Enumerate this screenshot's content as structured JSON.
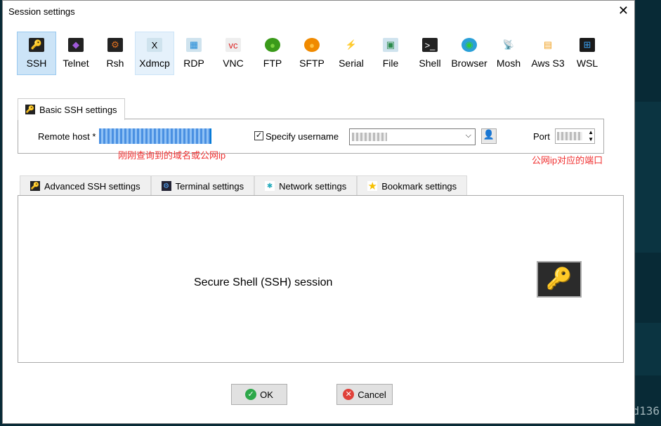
{
  "dialog": {
    "title": "Session settings",
    "close": "✕"
  },
  "session_types": [
    {
      "label": "SSH",
      "icon": "key-icon",
      "glyph": "🔑",
      "selected": true
    },
    {
      "label": "Telnet",
      "icon": "gem-icon",
      "glyph": "◆"
    },
    {
      "label": "Rsh",
      "icon": "gears-icon",
      "glyph": "⚙"
    },
    {
      "label": "Xdmcp",
      "icon": "x-monitor-icon",
      "glyph": "X"
    },
    {
      "label": "RDP",
      "icon": "windows-monitor-icon",
      "glyph": "▦"
    },
    {
      "label": "VNC",
      "icon": "vnc-monitor-icon",
      "glyph": "vc"
    },
    {
      "label": "FTP",
      "icon": "green-globe-icon",
      "glyph": "●"
    },
    {
      "label": "SFTP",
      "icon": "orange-globe-icon",
      "glyph": "●"
    },
    {
      "label": "Serial",
      "icon": "plug-icon",
      "glyph": "⚡"
    },
    {
      "label": "File",
      "icon": "file-monitor-icon",
      "glyph": "▣"
    },
    {
      "label": "Shell",
      "icon": "terminal-icon",
      "glyph": ">_"
    },
    {
      "label": "Browser",
      "icon": "globe-icon",
      "glyph": "◉"
    },
    {
      "label": "Mosh",
      "icon": "satellite-icon",
      "glyph": "📡"
    },
    {
      "label": "Aws S3",
      "icon": "cubes-icon",
      "glyph": "▤"
    },
    {
      "label": "WSL",
      "icon": "windows-icon",
      "glyph": "⊞"
    }
  ],
  "basic_tab": {
    "label": "Basic SSH settings"
  },
  "remote_host": {
    "label": "Remote host *"
  },
  "specify_username": {
    "label": "Specify username",
    "checked": true
  },
  "port": {
    "label": "Port"
  },
  "annotations": {
    "host": "刚刚查询到的域名或公网ip",
    "port": "公网ip对应的端口"
  },
  "adv_tabs": [
    {
      "label": "Advanced SSH settings",
      "icon": "key-icon"
    },
    {
      "label": "Terminal settings",
      "icon": "terminal-gear-icon"
    },
    {
      "label": "Network settings",
      "icon": "network-icon"
    },
    {
      "label": "Bookmark settings",
      "icon": "star-icon"
    }
  ],
  "panel": {
    "description": "Secure Shell (SSH) session"
  },
  "buttons": {
    "ok": "OK",
    "cancel": "Cancel"
  },
  "background": {
    "terminal_text": "d136"
  }
}
